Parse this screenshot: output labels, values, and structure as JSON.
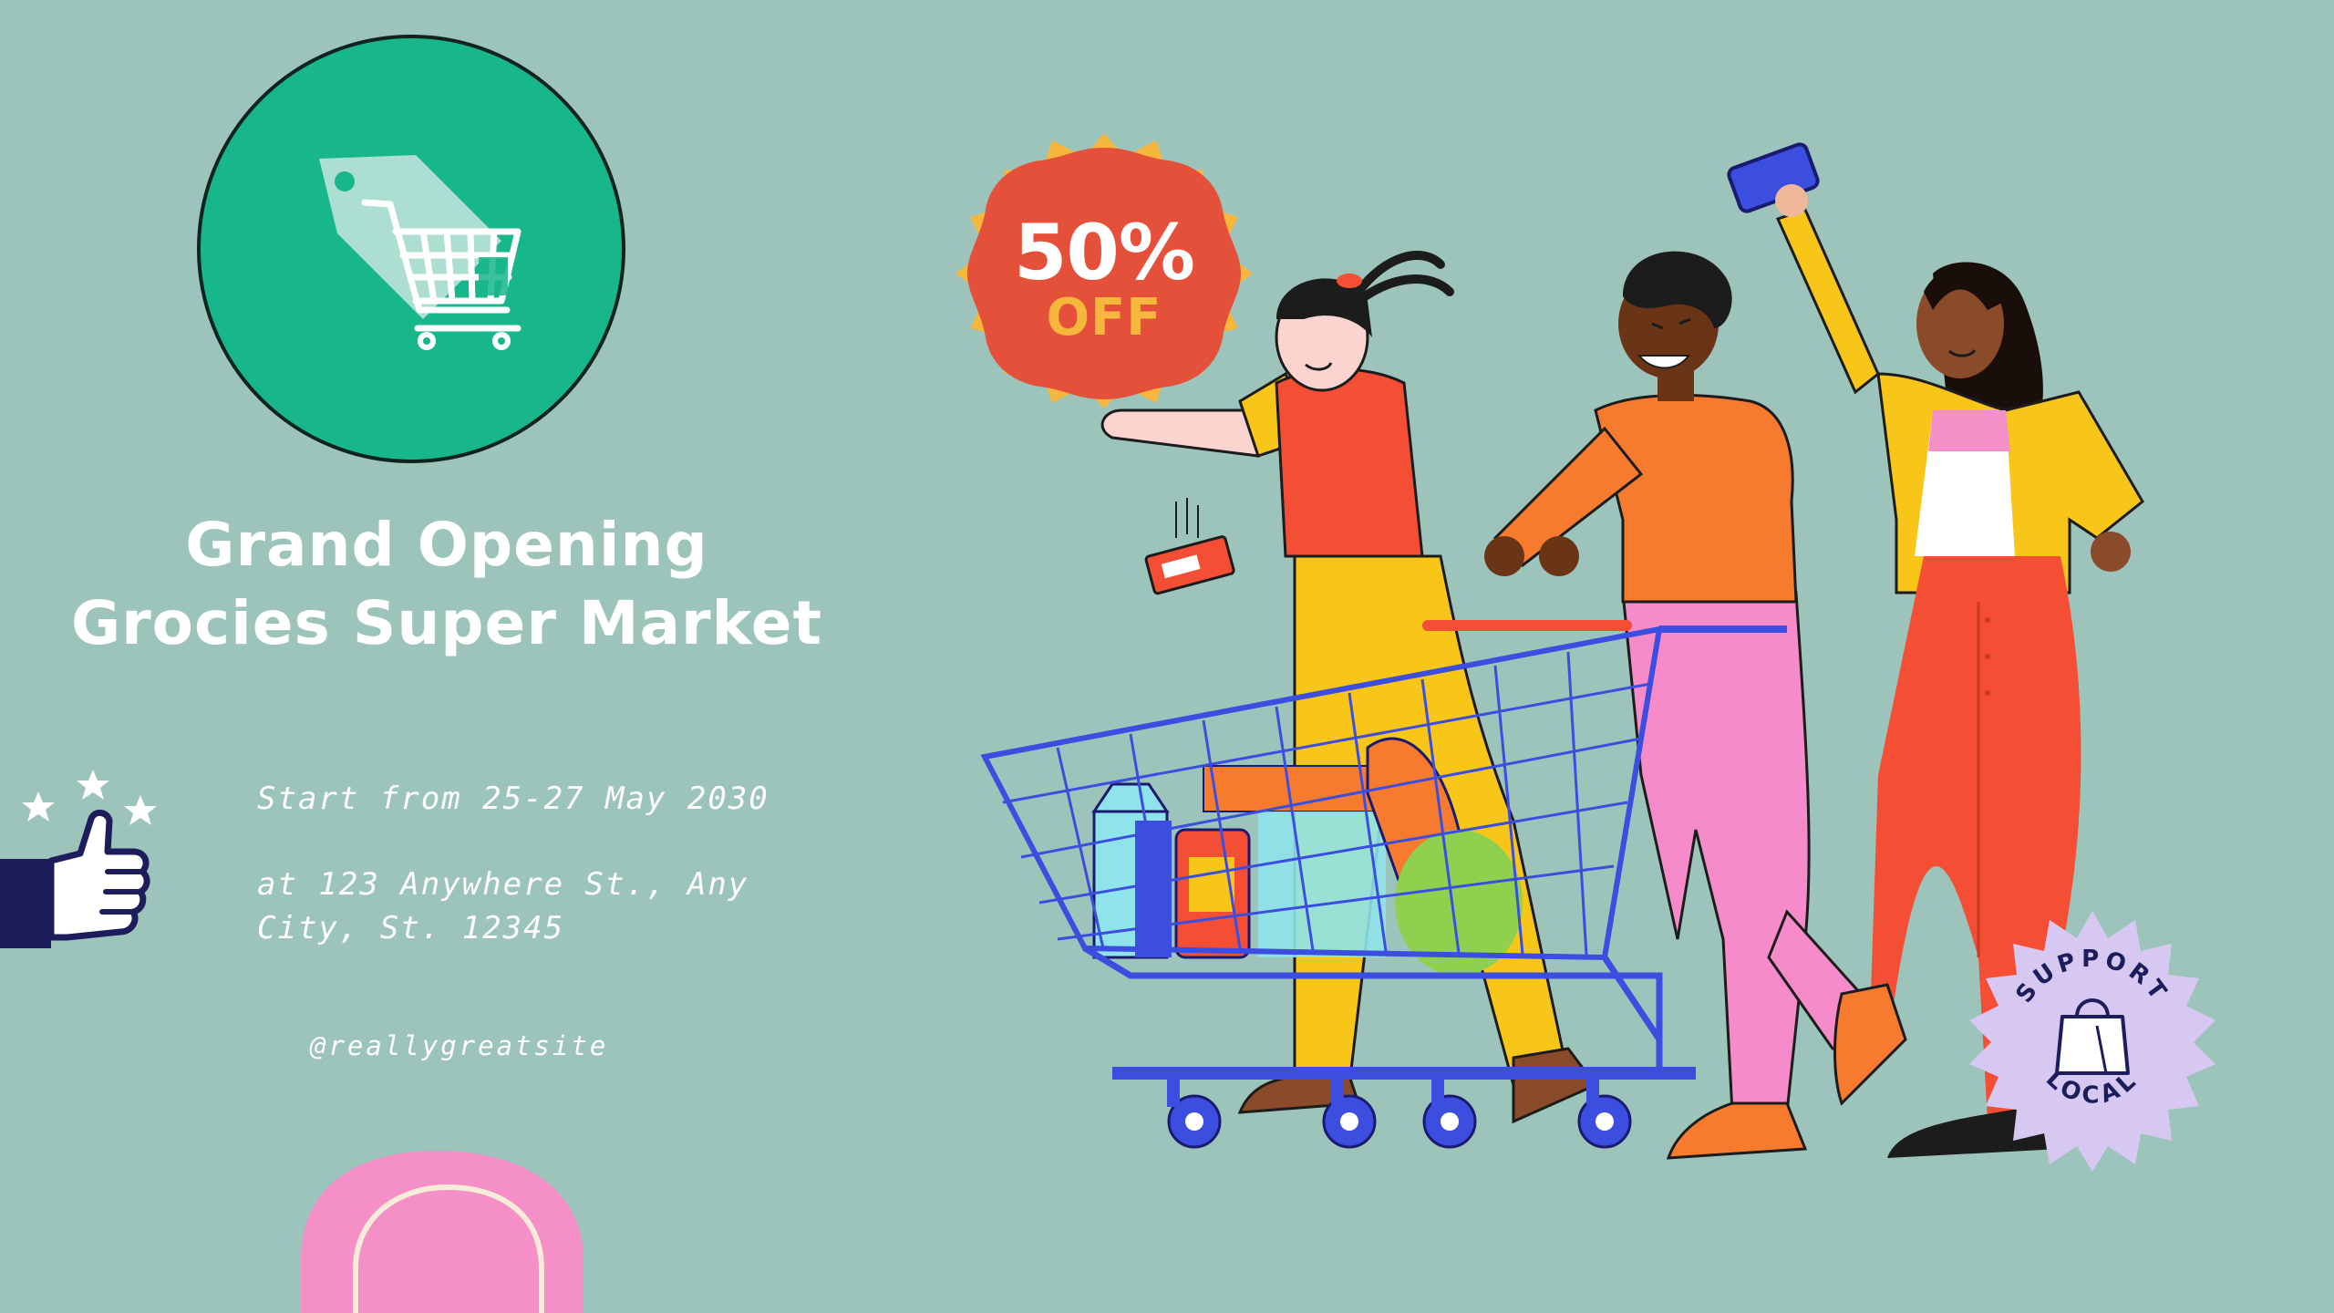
{
  "title": {
    "line1": "Grand Opening",
    "line2": "Grocies Super Market"
  },
  "event": {
    "date": "Start from 25-27 May 2030",
    "address_line1": "at 123 Anywhere St., Any",
    "address_line2": "City, St. 12345"
  },
  "social": {
    "handle": "@reallygreatsite"
  },
  "sale_badge": {
    "percent": "50%",
    "label": "OFF"
  },
  "support_badge": {
    "text": "SUPPORT LOCAL"
  },
  "icons": {
    "logo": "shopping-cart-price-tag-icon",
    "rating": "thumbs-up-with-stars-icon",
    "badge": "shopping-bag-icon"
  },
  "colors": {
    "background": "#9dc4ba",
    "logo_circle": "#17b68b",
    "sale_badge": "#e4503a",
    "sale_accent": "#f6b73c",
    "support_badge": "#d7c8f2",
    "pink_accent": "#f48fc7"
  }
}
